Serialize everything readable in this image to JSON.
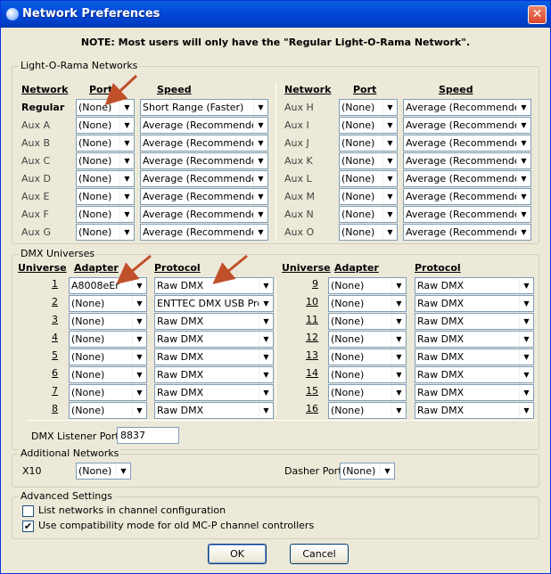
{
  "window": {
    "title": "Network Preferences",
    "close_glyph": "✕",
    "title_icon": "bulb-icon"
  },
  "note": "NOTE:  Most users will only have the \"Regular Light-O-Rama Network\".",
  "lor": {
    "legend": "Light-O-Rama Networks",
    "headers": {
      "network": "Network",
      "port": "Port",
      "speed": "Speed"
    },
    "left_rows": [
      {
        "label": "Regular",
        "port": "(None)",
        "speed": "Short Range (Faster)"
      },
      {
        "label": "Aux A",
        "port": "(None)",
        "speed": "Average (Recommended)"
      },
      {
        "label": "Aux B",
        "port": "(None)",
        "speed": "Average (Recommended)"
      },
      {
        "label": "Aux C",
        "port": "(None)",
        "speed": "Average (Recommended)"
      },
      {
        "label": "Aux D",
        "port": "(None)",
        "speed": "Average (Recommended)"
      },
      {
        "label": "Aux E",
        "port": "(None)",
        "speed": "Average (Recommended)"
      },
      {
        "label": "Aux F",
        "port": "(None)",
        "speed": "Average (Recommended)"
      },
      {
        "label": "Aux G",
        "port": "(None)",
        "speed": "Average (Recommended)"
      }
    ],
    "right_rows": [
      {
        "label": "Aux H",
        "port": "(None)",
        "speed": "Average (Recommended)"
      },
      {
        "label": "Aux I",
        "port": "(None)",
        "speed": "Average (Recommended)"
      },
      {
        "label": "Aux J",
        "port": "(None)",
        "speed": "Average (Recommended)"
      },
      {
        "label": "Aux K",
        "port": "(None)",
        "speed": "Average (Recommended)"
      },
      {
        "label": "Aux L",
        "port": "(None)",
        "speed": "Average (Recommended)"
      },
      {
        "label": "Aux M",
        "port": "(None)",
        "speed": "Average (Recommended)"
      },
      {
        "label": "Aux N",
        "port": "(None)",
        "speed": "Average (Recommended)"
      },
      {
        "label": "Aux O",
        "port": "(None)",
        "speed": "Average (Recommended)"
      }
    ]
  },
  "dmx": {
    "legend": "DMX Universes",
    "headers": {
      "universe": "Universe",
      "adapter": "Adapter",
      "protocol": "Protocol"
    },
    "left_rows": [
      {
        "num": "1",
        "adapter": "A8008eEr",
        "protocol": "Raw DMX"
      },
      {
        "num": "2",
        "adapter": "(None)",
        "protocol": "ENTTEC DMX USB Pro"
      },
      {
        "num": "3",
        "adapter": "(None)",
        "protocol": "Raw DMX"
      },
      {
        "num": "4",
        "adapter": "(None)",
        "protocol": "Raw DMX"
      },
      {
        "num": "5",
        "adapter": "(None)",
        "protocol": "Raw DMX"
      },
      {
        "num": "6",
        "adapter": "(None)",
        "protocol": "Raw DMX"
      },
      {
        "num": "7",
        "adapter": "(None)",
        "protocol": "Raw DMX"
      },
      {
        "num": "8",
        "adapter": "(None)",
        "protocol": "Raw DMX"
      }
    ],
    "right_rows": [
      {
        "num": "9",
        "adapter": "(None)",
        "protocol": "Raw DMX"
      },
      {
        "num": "10",
        "adapter": "(None)",
        "protocol": "Raw DMX"
      },
      {
        "num": "11",
        "adapter": "(None)",
        "protocol": "Raw DMX"
      },
      {
        "num": "12",
        "adapter": "(None)",
        "protocol": "Raw DMX"
      },
      {
        "num": "13",
        "adapter": "(None)",
        "protocol": "Raw DMX"
      },
      {
        "num": "14",
        "adapter": "(None)",
        "protocol": "Raw DMX"
      },
      {
        "num": "15",
        "adapter": "(None)",
        "protocol": "Raw DMX"
      },
      {
        "num": "16",
        "adapter": "(None)",
        "protocol": "Raw DMX"
      }
    ],
    "listener_label": "DMX Listener Port:",
    "listener_value": "8837"
  },
  "additional": {
    "legend": "Additional Networks",
    "x10_label": "X10",
    "x10_value": "(None)",
    "dasher_label": "Dasher Port",
    "dasher_value": "(None)"
  },
  "advanced": {
    "legend": "Advanced Settings",
    "list_networks_label": "List networks in channel configuration",
    "list_networks_checked": false,
    "compat_label": "Use compatibility mode for old MC-P channel controllers",
    "compat_checked": true
  },
  "buttons": {
    "ok": "OK",
    "cancel": "Cancel"
  },
  "colors": {
    "annotation_arrow": "#c0502a",
    "titlebar": "#0348d8"
  }
}
